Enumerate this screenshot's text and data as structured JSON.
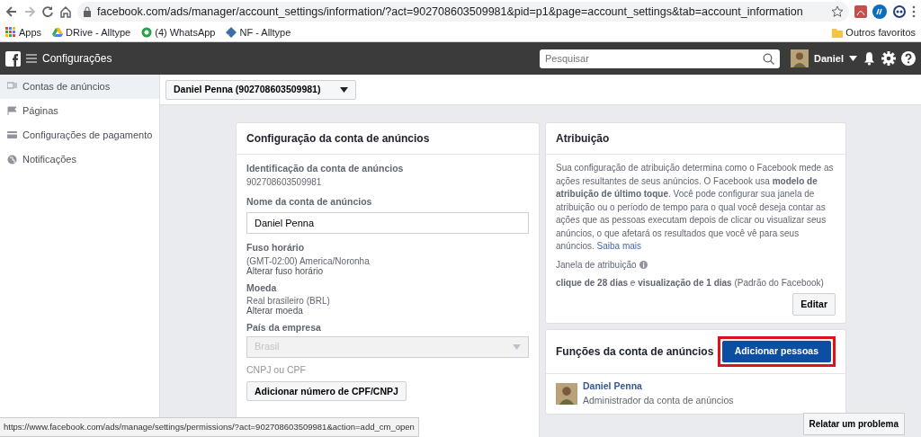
{
  "browser": {
    "url": "facebook.com/ads/manager/account_settings/information/?act=902708603509981&pid=p1&page=account_settings&tab=account_information",
    "bookmarks": [
      {
        "label": "Apps",
        "kind": "apps"
      },
      {
        "label": "DRive - Alltype",
        "kind": "drive"
      },
      {
        "label": "(4) WhatsApp",
        "kind": "whatsapp"
      },
      {
        "label": "NF - Alltype",
        "kind": "nf"
      }
    ],
    "other_bookmarks": "Outros favoritos"
  },
  "topbar": {
    "title": "Configurações",
    "search": {
      "placeholder": "Pesquisar"
    },
    "user": "Daniel"
  },
  "sidebar": {
    "items": [
      {
        "label": "Contas de anúncios",
        "kind": "accounts",
        "selected": true
      },
      {
        "label": "Páginas",
        "kind": "pages",
        "selected": false
      },
      {
        "label": "Configurações de pagamento",
        "kind": "payment",
        "selected": false
      },
      {
        "label": "Notificações",
        "kind": "notifications",
        "selected": false
      }
    ]
  },
  "account_selector": "Daniel Penna (902708603509981)",
  "account_card": {
    "title": "Configuração da conta de anúncios",
    "fields": [
      {
        "kind": "text",
        "label": "Identificação da conta de anúncios",
        "value": "902708603509981"
      },
      {
        "kind": "input",
        "label": "Nome da conta de anúncios",
        "value": "Daniel Penna"
      },
      {
        "kind": "text",
        "label": "Fuso horário",
        "value": "(GMT-02:00) America/Noronha",
        "link": "Alterar fuso horário"
      },
      {
        "kind": "text",
        "label": "Moeda",
        "value": "Real brasileiro (BRL)",
        "link": "Alterar moeda"
      },
      {
        "kind": "select",
        "label": "País da empresa",
        "value": "Brasil",
        "disabled": true
      },
      {
        "kind": "button",
        "label": "CNPJ ou CPF",
        "button": "Adicionar número de CPF/CNPJ"
      }
    ]
  },
  "attribution_card": {
    "title": "Atribuição",
    "description": "Sua configuração de atribuição determina como o Facebook mede as ações resultantes de seus anúncios. O Facebook usa **modelo de atribuição de último toque**. Você pode configurar sua janela de atribuição ou o período de tempo para o qual você deseja contar as ações que as pessoas executam depois de clicar ou visualizar seus anúncios, o que afetará os resultados que você vê para seus anúncios.",
    "learn_more": "Saiba mais",
    "window_label": "Janela de atribuição",
    "window_value": "**clique de 28 dias** e **visualização de 1 dias** (Padrão do Facebook)",
    "edit_button": "Editar"
  },
  "roles_card": {
    "title": "Funções da conta de anúncios",
    "add_button": "Adicionar pessoas",
    "add_highlighted": true,
    "people": [
      {
        "name": "Daniel Penna",
        "role": "Administrador da conta de anúncios"
      }
    ]
  },
  "status_url": "https://www.facebook.com/ads/manage/settings/permissions/?act=902708603509981&action=add_cm_open",
  "report_button": "Relatar um problema"
}
